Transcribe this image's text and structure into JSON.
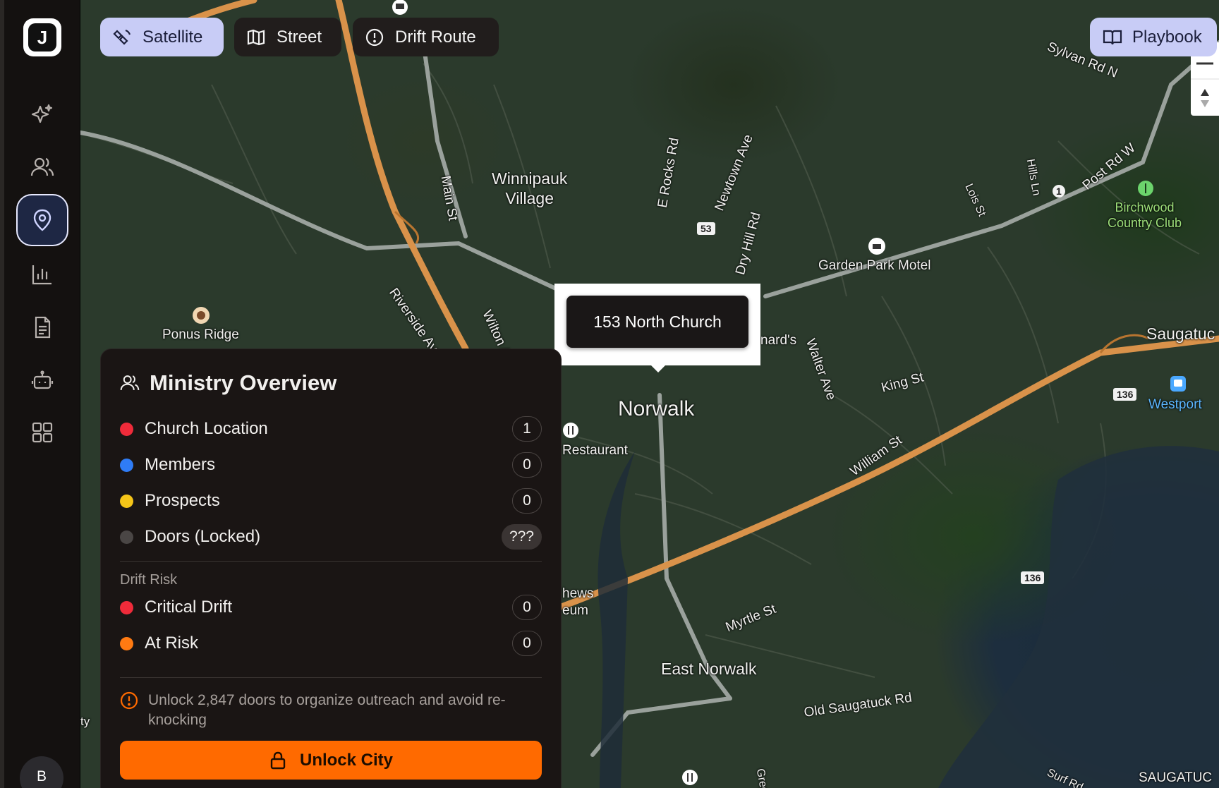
{
  "sidebar": {
    "logo_text": "J",
    "nav": [
      {
        "name": "sparkle-icon"
      },
      {
        "name": "users-icon"
      },
      {
        "name": "map-pin-icon",
        "active": true
      },
      {
        "name": "bar-chart-icon"
      },
      {
        "name": "document-icon"
      },
      {
        "name": "bot-icon"
      },
      {
        "name": "grid-icon"
      }
    ],
    "avatar_initial": "B"
  },
  "toolbar": {
    "satellite_label": "Satellite",
    "street_label": "Street",
    "drift_route_label": "Drift Route",
    "playbook_label": "Playbook"
  },
  "map": {
    "popup_label": "153 North Church",
    "labels": {
      "winnipauk": "Winnipauk\nVillage",
      "ponus": "Ponus Ridge",
      "norwalk": "Norwalk",
      "restaurant": "Restaurant",
      "garden_park": "Garden Park Motel",
      "birchwood": "Birchwood\nCountry Club",
      "westport": "Westport",
      "saugatuck": "Saugatuc",
      "saugatuck_bottom": "SAUGATUC",
      "east_norwalk": "East Norwalk",
      "old_saugatuck": "Old Saugatuck Rd",
      "main_st": "Main St",
      "riverside": "Riverside Av",
      "wilton": "Wilton A",
      "e_rocks": "E Rocks Rd",
      "newtown": "Newtown Ave",
      "dry_hill": "Dry Hill Rd",
      "lois": "Lois St",
      "hills": "Hills Ln",
      "post_rd": "Post Rd W",
      "sylvan": "Sylvan Rd N",
      "walter": "Walter Ave",
      "king": "King St",
      "william": "William St",
      "myrtle": "Myrtle St",
      "surf": "Surf Rd",
      "gregory": "Grego",
      "nards": "nard's",
      "hews": "hews",
      "eum": "eum",
      "ty": "ty"
    },
    "shields": {
      "r53": "53",
      "r1": "1",
      "r136a": "136",
      "r136b": "136"
    }
  },
  "overview": {
    "title": "Ministry Overview",
    "legend": [
      {
        "label": "Church Location",
        "count": "1",
        "color": "#ef2b3a"
      },
      {
        "label": "Members",
        "count": "0",
        "color": "#2f7cf6"
      },
      {
        "label": "Prospects",
        "count": "0",
        "color": "#f5c518"
      },
      {
        "label": "Doors (Locked)",
        "count": "???",
        "color": "#4a4645"
      }
    ],
    "drift_title": "Drift Risk",
    "drift": [
      {
        "label": "Critical Drift",
        "count": "0",
        "color": "#ef2b3a"
      },
      {
        "label": "At Risk",
        "count": "0",
        "color": "#ff7a12"
      }
    ],
    "notice": "Unlock 2,847 doors to organize outreach and avoid re-knocking",
    "unlock_label": "Unlock City"
  },
  "colors": {
    "accent": "#ff6a00",
    "toggle_active": "#c8ccf6",
    "panel_bg": "#1a1514"
  }
}
